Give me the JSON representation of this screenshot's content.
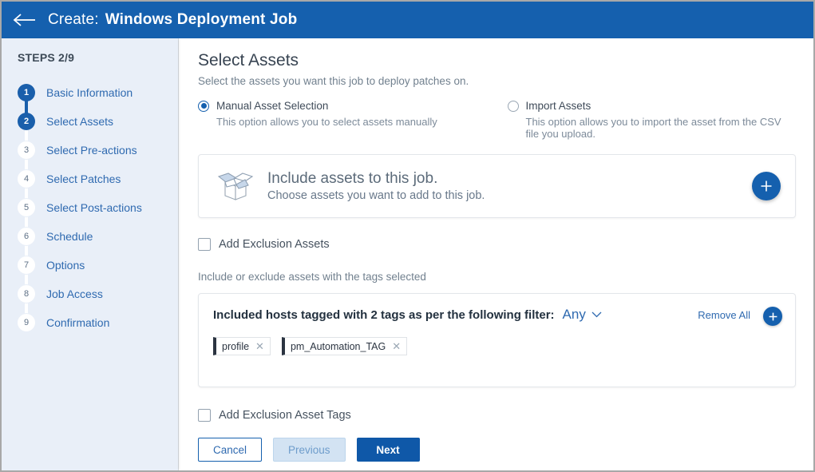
{
  "header": {
    "back_icon": "back-arrow-icon",
    "create_label": "Create:",
    "title": "Windows Deployment Job"
  },
  "sidebar": {
    "steps_label": "STEPS 2/9",
    "items": [
      {
        "num": "1",
        "label": "Basic Information",
        "state": "done"
      },
      {
        "num": "2",
        "label": "Select Assets",
        "state": "done"
      },
      {
        "num": "3",
        "label": "Select Pre-actions",
        "state": "todo"
      },
      {
        "num": "4",
        "label": "Select Patches",
        "state": "todo"
      },
      {
        "num": "5",
        "label": "Select Post-actions",
        "state": "todo"
      },
      {
        "num": "6",
        "label": "Schedule",
        "state": "todo"
      },
      {
        "num": "7",
        "label": "Options",
        "state": "todo"
      },
      {
        "num": "8",
        "label": "Job Access",
        "state": "todo"
      },
      {
        "num": "9",
        "label": "Confirmation",
        "state": "todo"
      }
    ]
  },
  "main": {
    "title": "Select Assets",
    "subtitle": "Select the assets you want this job to deploy patches on.",
    "options": [
      {
        "label": "Manual Asset Selection",
        "description": "This option allows you to select assets manually",
        "selected": true
      },
      {
        "label": "Import Assets",
        "description": "This option allows you to import the asset from the CSV file you upload.",
        "selected": false
      }
    ],
    "include_card": {
      "icon": "open-box-icon",
      "title": "Include assets to this job.",
      "subtitle": "Choose assets you want to add to this job.",
      "add_button": "add-assets-button"
    },
    "exclusion_assets": {
      "label": "Add Exclusion Assets",
      "checked": false
    },
    "tags_helper": "Include or exclude assets with the tags selected",
    "tag_filter": {
      "heading": "Included hosts tagged with 2 tags as per the following filter:",
      "match_mode": "Any",
      "remove_all": "Remove All",
      "add_button": "add-tag-button",
      "tags": [
        {
          "name": "profile"
        },
        {
          "name": "pm_Automation_TAG"
        }
      ]
    },
    "exclusion_asset_tags": {
      "label": "Add Exclusion Asset Tags",
      "checked": false
    },
    "buttons": {
      "cancel": "Cancel",
      "previous": "Previous",
      "next": "Next"
    }
  },
  "colors": {
    "header_blue": "#1560ae",
    "accent_blue": "#2f6ab0",
    "sidebar_bg": "#e9eff8",
    "next_blue": "#0f58a8",
    "chip_bar": "#2b3441"
  }
}
